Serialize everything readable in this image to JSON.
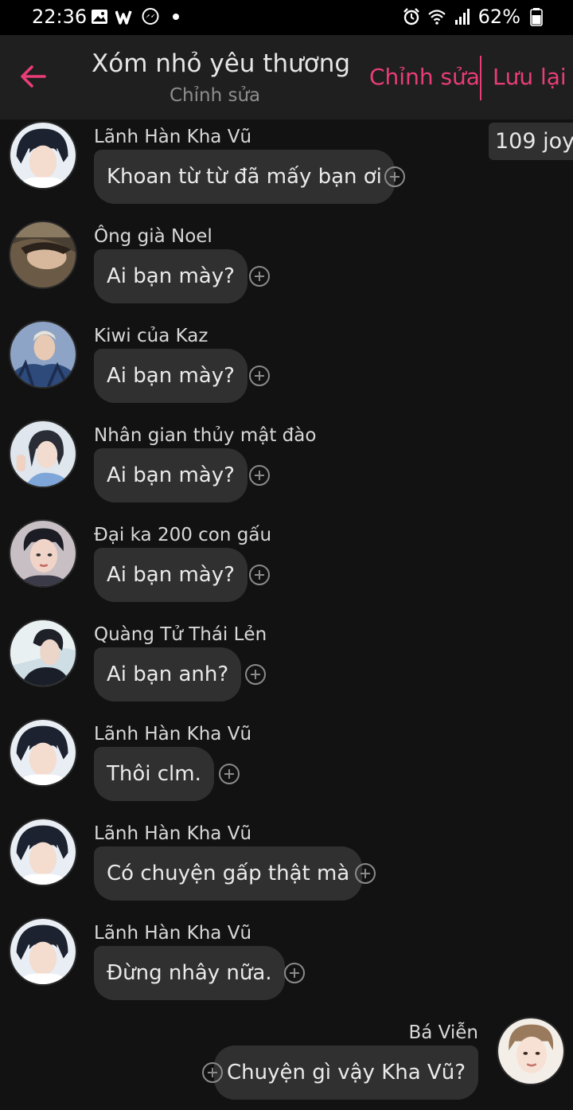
{
  "status_bar": {
    "time": "22:36",
    "battery": "62%",
    "left_icons": [
      "image-icon",
      "w-app-icon",
      "messenger-icon",
      "dot-icon"
    ],
    "right_icons": [
      "alarm-icon",
      "wifi-icon",
      "signal-icon",
      "battery-icon"
    ]
  },
  "header": {
    "title": "Xóm nhỏ yêu thương",
    "subtitle": "Chỉnh sửa",
    "edit_label": "Chỉnh sửa",
    "save_label": "Lưu lại",
    "accent_color": "#ea3d78"
  },
  "joy_badge": "109 joy",
  "messages": [
    {
      "sender": "Lãnh Hàn Kha Vũ",
      "text": "Khoan từ từ đã mấy bạn ơi",
      "avatar": "avatar-icon",
      "direction": "in"
    },
    {
      "sender": "Ông già Noel",
      "text": "Ai bạn mày?",
      "avatar": "avatar-icon",
      "direction": "in"
    },
    {
      "sender": "Kiwi của Kaz",
      "text": "Ai bạn mày?",
      "avatar": "avatar-icon",
      "direction": "in"
    },
    {
      "sender": "Nhân gian thủy mật đào",
      "text": "Ai bạn mày?",
      "avatar": "avatar-icon",
      "direction": "in"
    },
    {
      "sender": "Đại ka 200 con gấu",
      "text": "Ai bạn mày?",
      "avatar": "avatar-icon",
      "direction": "in"
    },
    {
      "sender": "Quàng Tử Thái Lẻn",
      "text": "Ai bạn anh?",
      "avatar": "avatar-icon",
      "direction": "in"
    },
    {
      "sender": "Lãnh Hàn Kha Vũ",
      "text": "Thôi clm.",
      "avatar": "avatar-icon",
      "direction": "in"
    },
    {
      "sender": "Lãnh Hàn Kha Vũ",
      "text": "Có chuyện gấp thật mà",
      "avatar": "avatar-icon",
      "direction": "in"
    },
    {
      "sender": "Lãnh Hàn Kha Vũ",
      "text": "Đừng nhây nữa.",
      "avatar": "avatar-icon",
      "direction": "in"
    },
    {
      "sender": "Bá Viễn",
      "text": "Chuyện gì vậy Kha Vũ?",
      "avatar": "avatar-icon",
      "direction": "out"
    }
  ]
}
